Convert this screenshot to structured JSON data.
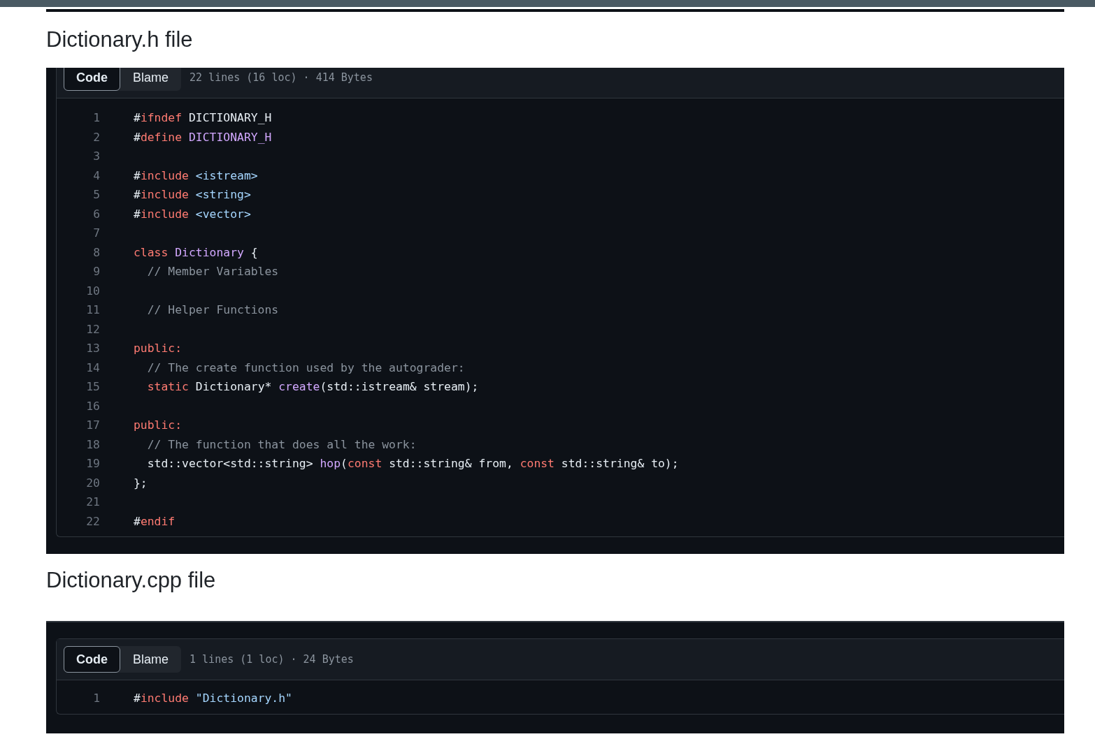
{
  "sections": [
    {
      "title": "Dictionary.h file",
      "clipped_top": true,
      "tabs": [
        {
          "label": "Code",
          "selected": true
        },
        {
          "label": "Blame",
          "selected": false
        }
      ],
      "summary": "22 lines (16 loc) · 414 Bytes",
      "lines": [
        {
          "number": "1",
          "tokens": [
            {
              "kind": "plain",
              "text": "#"
            },
            {
              "kind": "keyword",
              "text": "ifndef"
            },
            {
              "kind": "plain",
              "text": " DICTIONARY_H"
            }
          ]
        },
        {
          "number": "2",
          "tokens": [
            {
              "kind": "plain",
              "text": "#"
            },
            {
              "kind": "keyword",
              "text": "define"
            },
            {
              "kind": "entity",
              "text": " DICTIONARY_H"
            }
          ]
        },
        {
          "number": "3"
        },
        {
          "number": "4",
          "tokens": [
            {
              "kind": "plain",
              "text": "#"
            },
            {
              "kind": "keyword",
              "text": "include"
            },
            {
              "kind": "string",
              "text": " <istream>"
            }
          ]
        },
        {
          "number": "5",
          "tokens": [
            {
              "kind": "plain",
              "text": "#"
            },
            {
              "kind": "keyword",
              "text": "include"
            },
            {
              "kind": "string",
              "text": " <string>"
            }
          ]
        },
        {
          "number": "6",
          "tokens": [
            {
              "kind": "plain",
              "text": "#"
            },
            {
              "kind": "keyword",
              "text": "include"
            },
            {
              "kind": "string",
              "text": " <vector>"
            }
          ]
        },
        {
          "number": "7"
        },
        {
          "number": "8",
          "tokens": [
            {
              "kind": "keyword",
              "text": "class"
            },
            {
              "kind": "entity",
              "text": " Dictionary"
            },
            {
              "kind": "plain",
              "text": " {"
            }
          ]
        },
        {
          "number": "9",
          "tokens": [
            {
              "kind": "comment",
              "text": "  // Member Variables"
            }
          ]
        },
        {
          "number": "10"
        },
        {
          "number": "11",
          "tokens": [
            {
              "kind": "comment",
              "text": "  // Helper Functions"
            }
          ]
        },
        {
          "number": "12"
        },
        {
          "number": "13",
          "tokens": [
            {
              "kind": "keyword",
              "text": "public:"
            }
          ]
        },
        {
          "number": "14",
          "tokens": [
            {
              "kind": "comment",
              "text": "  // The create function used by the autograder:"
            }
          ]
        },
        {
          "number": "15",
          "tokens": [
            {
              "kind": "keyword",
              "text": "  static"
            },
            {
              "kind": "plain",
              "text": " Dictionary* "
            },
            {
              "kind": "entity",
              "text": "create"
            },
            {
              "kind": "plain",
              "text": "(std::istream& stream);"
            }
          ]
        },
        {
          "number": "16"
        },
        {
          "number": "17",
          "tokens": [
            {
              "kind": "keyword",
              "text": "public:"
            }
          ]
        },
        {
          "number": "18",
          "tokens": [
            {
              "kind": "comment",
              "text": "  // The function that does all the work:"
            }
          ]
        },
        {
          "number": "19",
          "tokens": [
            {
              "kind": "plain",
              "text": "  std::vector<std::string> "
            },
            {
              "kind": "entity",
              "text": "hop"
            },
            {
              "kind": "plain",
              "text": "("
            },
            {
              "kind": "keyword",
              "text": "const"
            },
            {
              "kind": "plain",
              "text": " std::string& from, "
            },
            {
              "kind": "keyword",
              "text": "const"
            },
            {
              "kind": "plain",
              "text": " std::string& to);"
            }
          ]
        },
        {
          "number": "20",
          "tokens": [
            {
              "kind": "plain",
              "text": "};"
            }
          ]
        },
        {
          "number": "21"
        },
        {
          "number": "22",
          "tokens": [
            {
              "kind": "plain",
              "text": "#"
            },
            {
              "kind": "keyword",
              "text": "endif"
            }
          ]
        }
      ]
    },
    {
      "title": "Dictionary.cpp file",
      "clipped_top": false,
      "tabs": [
        {
          "label": "Code",
          "selected": true
        },
        {
          "label": "Blame",
          "selected": false
        }
      ],
      "summary": "1 lines (1 loc) · 24 Bytes",
      "lines": [
        {
          "number": "1",
          "tokens": [
            {
              "kind": "plain",
              "text": "#"
            },
            {
              "kind": "keyword",
              "text": "include"
            },
            {
              "kind": "string",
              "text": " \"Dictionary.h\""
            }
          ]
        }
      ]
    }
  ]
}
